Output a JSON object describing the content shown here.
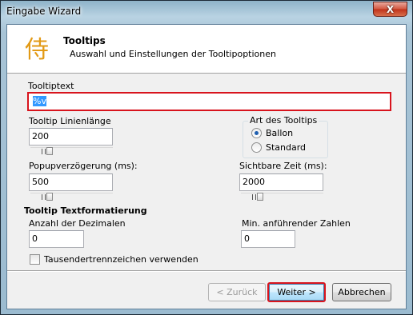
{
  "window": {
    "title": "Eingabe Wizard",
    "close_symbol": "X"
  },
  "header": {
    "icon_glyph": "侍",
    "title": "Tooltips",
    "subtitle": "Auswahl und Einstellungen der Tooltipoptionen"
  },
  "tooltiptext": {
    "label": "Tooltiptext",
    "value": "%v"
  },
  "line_length": {
    "label": "Tooltip Linienlänge",
    "value": "200",
    "slider_level": 0.2
  },
  "tooltip_type": {
    "label": "Art des Tooltips",
    "options": [
      {
        "label": "Ballon",
        "selected": true
      },
      {
        "label": "Standard",
        "selected": false
      }
    ]
  },
  "popup_delay": {
    "label": "Popupverzögerung (ms):",
    "value": "500",
    "slider_level": 0.2
  },
  "visible_time": {
    "label": "Sichtbare Zeit (ms):",
    "value": "2000",
    "slider_level": 0.2
  },
  "formatting": {
    "title": "Tooltip Textformatierung",
    "decimals_label": "Anzahl der Dezimalen",
    "decimals_value": "0",
    "leading_label": "Min. anführender Zahlen",
    "leading_value": "0",
    "thousands_label": "Tausendertrennzeichen verwenden",
    "thousands_checked": false
  },
  "buttons": {
    "back": "< Zurück",
    "next": "Weiter >",
    "cancel": "Abbrechen"
  },
  "colors": {
    "highlight": "#d8141d",
    "icon": "#e29a16"
  }
}
